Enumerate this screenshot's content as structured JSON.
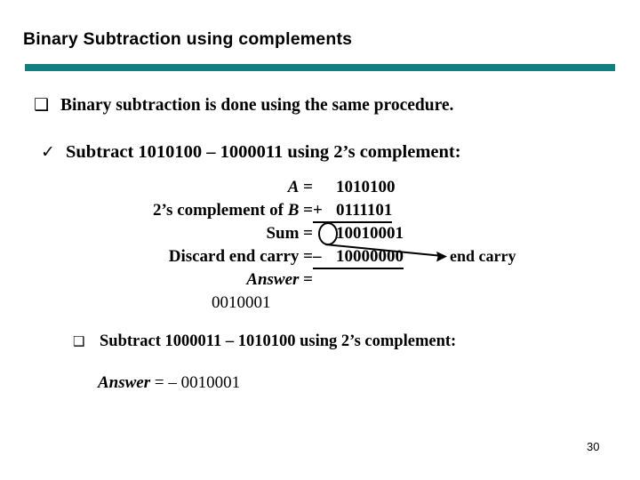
{
  "slide": {
    "title": "Binary Subtraction using complements",
    "page_number": "30",
    "accent_color": "#0f7f80"
  },
  "bullets": [
    {
      "glyph": "❑",
      "glyph_name": "pages-bullet-icon",
      "text": "Binary subtraction is done using the same procedure."
    },
    {
      "glyph": "✓",
      "glyph_name": "checkmark-bullet-icon",
      "text": "Subtract 1010100 – 1000011 using 2’s complement:"
    },
    {
      "glyph": "❑",
      "glyph_name": "hollow-square-bullet-icon",
      "text": "Subtract 1000011 – 1010100  using 2’s complement:"
    }
  ],
  "calculation": {
    "rows": [
      {
        "label_prefix": "",
        "label_italic": "A",
        "label_suffix": " =",
        "operator": "",
        "value": "1010100",
        "ruled": false
      },
      {
        "label_prefix": "2’s complement of ",
        "label_italic": "B",
        "label_suffix": "  =",
        "operator": "+",
        "value": "0111101",
        "ruled": true
      },
      {
        "label_prefix": "Sum =",
        "label_italic": "",
        "label_suffix": "",
        "operator": "",
        "value": "10010001",
        "ruled": false
      },
      {
        "label_prefix": "Discard end carry =",
        "label_italic": "",
        "label_suffix": "",
        "operator": "–",
        "value": "10000000",
        "ruled": true
      },
      {
        "label_prefix": "",
        "label_italic": "Answer",
        "label_suffix": " =",
        "operator": "",
        "value": "",
        "ruled": false
      }
    ],
    "answer_bits": "0010001",
    "end_carry_annotation": "end carry"
  },
  "final_answer": {
    "label": "Answer",
    "value": " = – 0010001"
  }
}
